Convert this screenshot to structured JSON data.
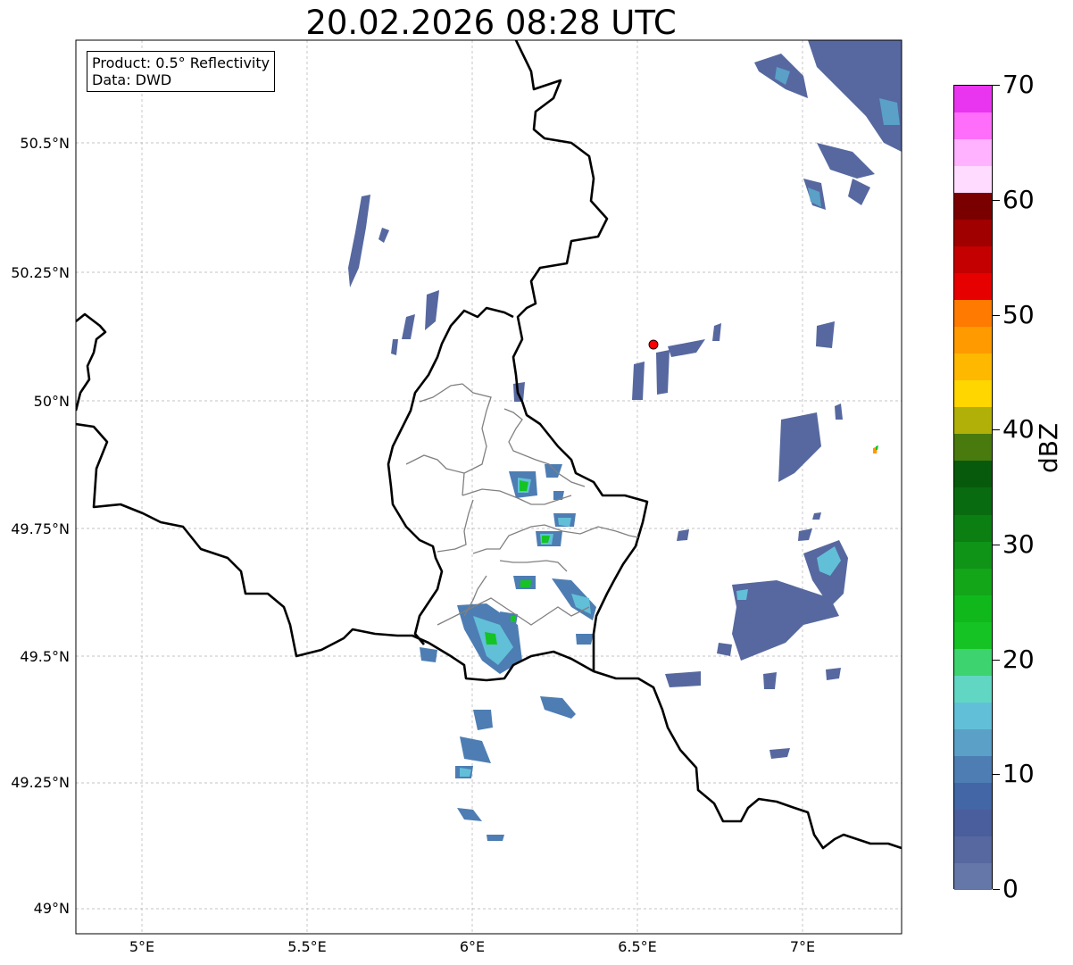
{
  "title": "20.02.2026 08:28 UTC",
  "infobox": {
    "line1": "Product: 0.5° Reflectivity",
    "line2": "Data: DWD"
  },
  "y_ticks": [
    "50.5°N",
    "50.25°N",
    "50°N",
    "49.75°N",
    "49.5°N",
    "49.25°N",
    "49°N"
  ],
  "x_ticks": [
    "5°E",
    "5.5°E",
    "6°E",
    "6.5°E",
    "7°E"
  ],
  "colorbar": {
    "label": "dBZ",
    "ticks": [
      "0",
      "10",
      "20",
      "30",
      "40",
      "50",
      "60",
      "70"
    ],
    "colors": [
      "#6576a8",
      "#56689f",
      "#4a5e9d",
      "#4266a6",
      "#4d7db3",
      "#5aa0c7",
      "#62bfd8",
      "#61d7c3",
      "#3dd470",
      "#15c424",
      "#10b81c",
      "#12a618",
      "#0f9417",
      "#0c7f13",
      "#096b10",
      "#075a0b",
      "#497a0d",
      "#b0b008",
      "#ffd600",
      "#ffb800",
      "#ff9a00",
      "#ff7a00",
      "#e60000",
      "#c40000",
      "#a00000",
      "#7a0000",
      "#ffdcff",
      "#ffb2ff",
      "#ff6efa",
      "#e935f0"
    ]
  },
  "radar_site_color": "#ff0000",
  "borders_color": "#000000",
  "cantons_color": "#808080"
}
